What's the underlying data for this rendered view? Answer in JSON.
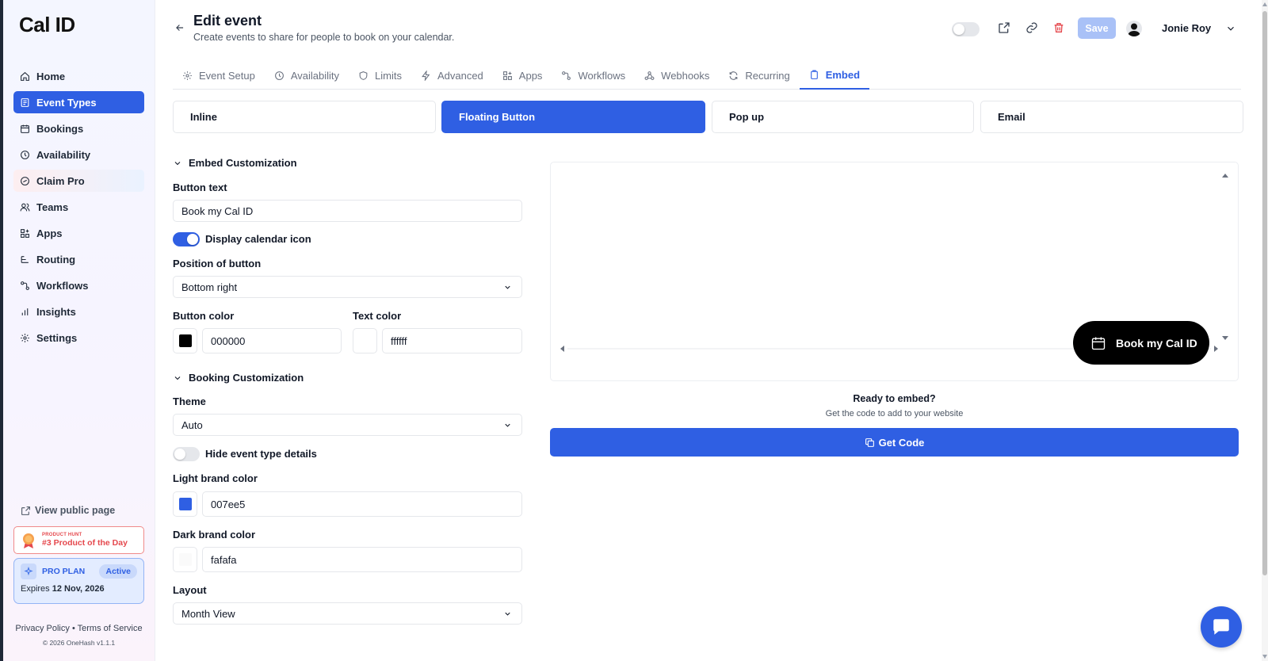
{
  "brand": {
    "logo": "Cal ID",
    "accent": "#2f5fe3"
  },
  "sidebar": {
    "items": [
      {
        "label": "Home",
        "icon": "home-icon"
      },
      {
        "label": "Event Types",
        "icon": "event-types-icon",
        "active": true
      },
      {
        "label": "Bookings",
        "icon": "calendar-icon"
      },
      {
        "label": "Availability",
        "icon": "clock-icon"
      },
      {
        "label": "Claim Pro",
        "icon": "badge-icon"
      },
      {
        "label": "Teams",
        "icon": "users-icon"
      },
      {
        "label": "Apps",
        "icon": "apps-icon"
      },
      {
        "label": "Routing",
        "icon": "routing-icon"
      },
      {
        "label": "Workflows",
        "icon": "workflow-icon"
      },
      {
        "label": "Insights",
        "icon": "bar-chart-icon"
      },
      {
        "label": "Settings",
        "icon": "gear-icon"
      }
    ],
    "view_public": "View public page",
    "product_hunt": {
      "small": "PRODUCT HUNT",
      "big": "#3 Product of the Day"
    },
    "pro_plan": {
      "label": "PRO PLAN",
      "status": "Active",
      "expires_prefix": "Expires",
      "expires_date": "12 Nov, 2026"
    },
    "footer": {
      "privacy": "Privacy Policy",
      "separator": "•",
      "terms": "Terms of Service",
      "copyright": "© 2026 OneHash v1.1.1"
    }
  },
  "header": {
    "title": "Edit event",
    "subtitle": "Create events to share for people to book on your calendar.",
    "save_label": "Save",
    "user_name": "Jonie Roy"
  },
  "tabs": [
    {
      "label": "Event Setup",
      "icon": "gear-icon"
    },
    {
      "label": "Availability",
      "icon": "clock-icon"
    },
    {
      "label": "Limits",
      "icon": "shield-icon"
    },
    {
      "label": "Advanced",
      "icon": "bolt-icon"
    },
    {
      "label": "Apps",
      "icon": "apps-icon"
    },
    {
      "label": "Workflows",
      "icon": "workflow-icon"
    },
    {
      "label": "Webhooks",
      "icon": "webhook-icon"
    },
    {
      "label": "Recurring",
      "icon": "repeat-icon"
    },
    {
      "label": "Embed",
      "icon": "clipboard-icon",
      "active": true
    }
  ],
  "embed_types": [
    "Inline",
    "Floating Button",
    "Pop up",
    "Email"
  ],
  "embed_customization": {
    "heading": "Embed Customization",
    "button_text_label": "Button text",
    "button_text_value": "Book my Cal ID",
    "display_icon_label": "Display calendar icon",
    "display_icon_on": true,
    "position_label": "Position of button",
    "position_value": "Bottom right",
    "button_color_label": "Button color",
    "button_color_value": "000000",
    "button_color_hex": "#000000",
    "text_color_label": "Text color",
    "text_color_value": "ffffff",
    "text_color_hex": "#ffffff"
  },
  "booking_customization": {
    "heading": "Booking Customization",
    "theme_label": "Theme",
    "theme_value": "Auto",
    "hide_details_label": "Hide event type details",
    "hide_details_on": false,
    "light_brand_label": "Light brand color",
    "light_brand_value": "007ee5",
    "light_brand_hex": "#2f5fe3",
    "dark_brand_label": "Dark brand color",
    "dark_brand_value": "fafafa",
    "dark_brand_hex": "#fafafa",
    "layout_label": "Layout",
    "layout_value": "Month View"
  },
  "preview": {
    "floating_button_text": "Book my Cal ID",
    "ready_title": "Ready to embed?",
    "ready_subtitle": "Get the code to add to your website",
    "get_code_label": "Get Code"
  }
}
